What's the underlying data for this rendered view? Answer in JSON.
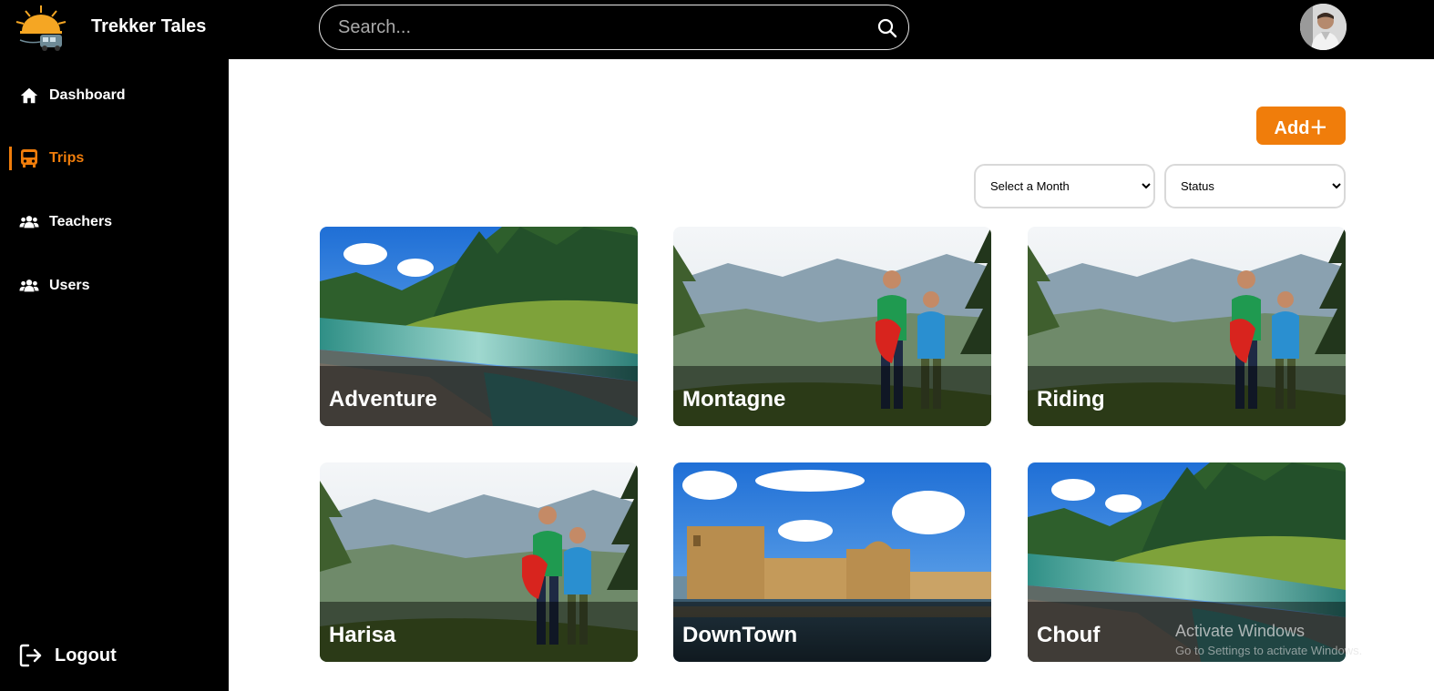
{
  "app": {
    "title": "Trekker Tales"
  },
  "search": {
    "placeholder": "Search..."
  },
  "sidebar": {
    "items": [
      {
        "label": "Dashboard",
        "icon": "home-icon"
      },
      {
        "label": "Trips",
        "icon": "bus-icon",
        "active": true
      },
      {
        "label": "Teachers",
        "icon": "users-group-icon"
      },
      {
        "label": "Users",
        "icon": "users-group-icon"
      }
    ],
    "logout": "Logout"
  },
  "toolbar": {
    "add_label": "Add＋"
  },
  "filters": {
    "month": {
      "selected": "Select a Month"
    },
    "status": {
      "selected": "Status"
    }
  },
  "trips": [
    {
      "title": "Adventure",
      "image": "river"
    },
    {
      "title": "Montagne",
      "image": "kids-mountain"
    },
    {
      "title": "Riding",
      "image": "kids-mountain"
    },
    {
      "title": "Harisa",
      "image": "kids-mountain"
    },
    {
      "title": "DownTown",
      "image": "sea-castle"
    },
    {
      "title": "Chouf",
      "image": "river"
    }
  ],
  "watermark": {
    "line1": "Activate Windows",
    "line2": "Go to Settings to activate Windows."
  },
  "colors": {
    "accent": "#f07d0b",
    "bar": "#000000"
  }
}
